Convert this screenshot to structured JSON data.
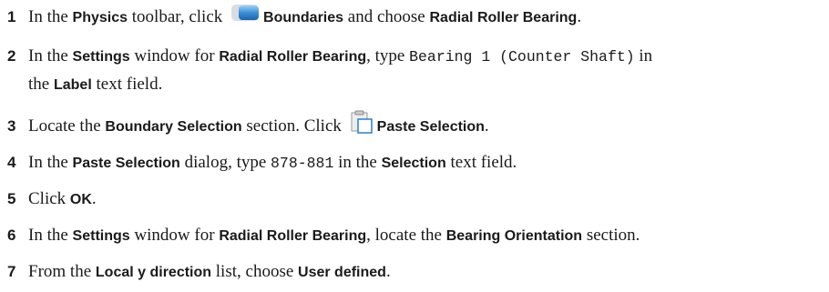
{
  "steps": [
    {
      "number": "1",
      "t1": "In the ",
      "toolbar": "Physics",
      "t2": " toolbar, click ",
      "button": "Boundaries",
      "t3": " and choose ",
      "choice": "Radial Roller Bearing",
      "t4": "."
    },
    {
      "number": "2",
      "t1": "In the ",
      "window": "Settings",
      "t2": " window for ",
      "feature": "Radial Roller Bearing",
      "t3": ", type ",
      "value": "Bearing 1 (Counter Shaft)",
      "t4": " in",
      "t5": "the ",
      "field": "Label",
      "t6": " text field."
    },
    {
      "number": "3",
      "t1": "Locate the ",
      "section": "Boundary Selection",
      "t2": " section. Click ",
      "button": "Paste Selection",
      "t3": "."
    },
    {
      "number": "4",
      "t1": "In the ",
      "dialog": "Paste Selection",
      "t2": " dialog, type ",
      "value": "878-881",
      "t3": " in the ",
      "field": "Selection",
      "t4": " text field."
    },
    {
      "number": "5",
      "t1": "Click ",
      "button": "OK",
      "t2": "."
    },
    {
      "number": "6",
      "t1": "In the ",
      "window": "Settings",
      "t2": " window for ",
      "feature": "Radial Roller Bearing",
      "t3": ", locate the ",
      "section": "Bearing Orientation",
      "t4": " section."
    },
    {
      "number": "7",
      "t1": "From the ",
      "list": "Local y direction",
      "t2": " list, choose ",
      "choice": "User defined",
      "t3": "."
    }
  ],
  "icons": {
    "boundaries": "boundaries-icon",
    "paste_selection": "paste-selection-icon"
  }
}
